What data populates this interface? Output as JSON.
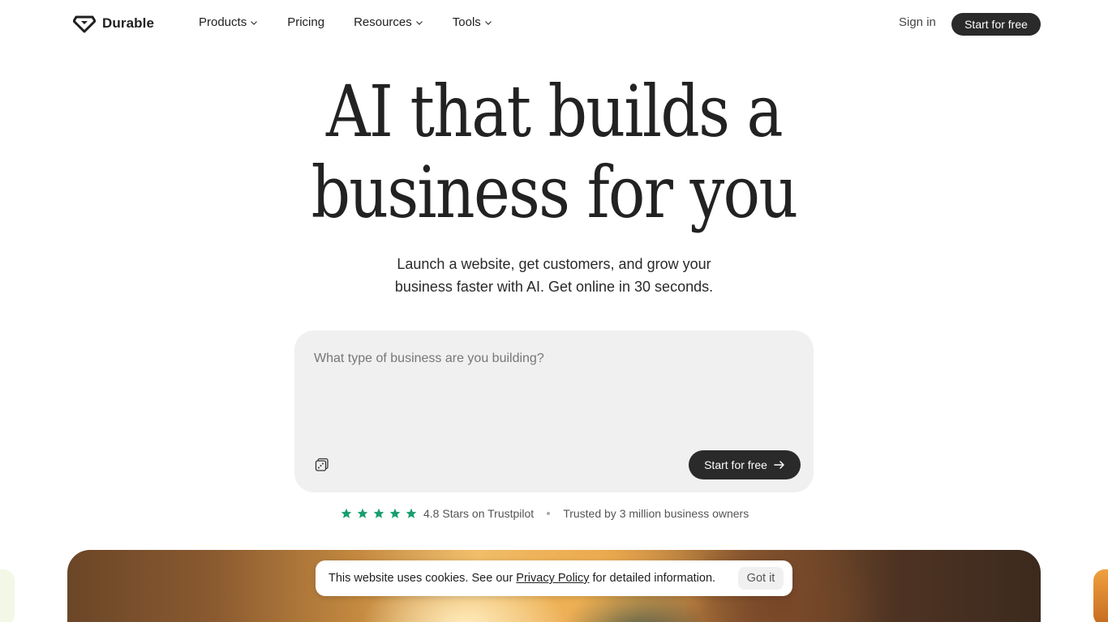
{
  "header": {
    "logo_text": "Durable",
    "nav": [
      {
        "label": "Products",
        "has_dropdown": true
      },
      {
        "label": "Pricing",
        "has_dropdown": false
      },
      {
        "label": "Resources",
        "has_dropdown": true
      },
      {
        "label": "Tools",
        "has_dropdown": true
      }
    ],
    "sign_in": "Sign in",
    "start_button": "Start for free"
  },
  "hero": {
    "title_line1": "AI that builds a",
    "title_line2": "business for you",
    "subtitle_line1": "Launch a website, get customers, and grow your",
    "subtitle_line2": "business faster with AI. Get online in 30 seconds."
  },
  "prompt": {
    "placeholder": "What type of business are you building?",
    "value": "",
    "random_icon": "dice-icon",
    "submit_label": "Start for free",
    "submit_icon": "arrow-right-icon"
  },
  "trust": {
    "stars": 5,
    "rating_text": "4.8 Stars on Trustpilot",
    "trusted_text": "Trusted by 3 million business owners",
    "star_color": "#1a9e6e"
  },
  "cookie": {
    "text_before": "This website uses cookies. See our",
    "link": "Privacy Policy",
    "text_after": "for detailed information.",
    "button": "Got it"
  },
  "colors": {
    "primary_button": "#2a2a2a",
    "prompt_bg": "#f0f0f0"
  }
}
